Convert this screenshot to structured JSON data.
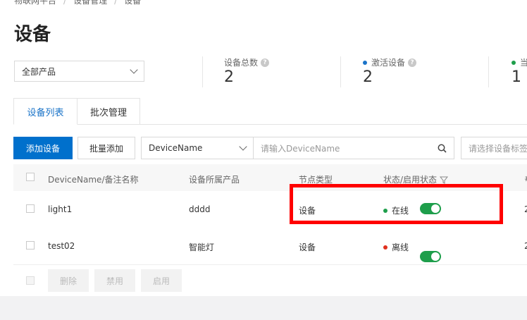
{
  "breadcrumb": [
    "物联网平台",
    "设备管理",
    "设备"
  ],
  "page_title": "设备",
  "product_filter": {
    "value": "全部产品"
  },
  "stats": [
    {
      "label": "设备总数",
      "value": "2",
      "dot_color": null
    },
    {
      "label": "激活设备",
      "value": "2",
      "dot_color": "#1a73c8"
    },
    {
      "label": "当",
      "value": "1",
      "dot_color": "#1e9e4b"
    }
  ],
  "tabs": [
    {
      "label": "设备列表",
      "active": true
    },
    {
      "label": "批次管理",
      "active": false
    }
  ],
  "toolbar": {
    "add_device": "添加设备",
    "batch_add": "批量添加",
    "search_field": "DeviceName",
    "search_placeholder": "请输入DeviceName",
    "tag_placeholder": "请选择设备标签"
  },
  "table": {
    "headers": [
      "DeviceName/备注名称",
      "设备所属产品",
      "节点类型",
      "状态/启用状态"
    ],
    "rows": [
      {
        "name": "light1",
        "product": "dddd",
        "node_type": "设备",
        "status": "在线",
        "status_color": "#1e9e4b",
        "enabled": true,
        "extra": "2"
      },
      {
        "name": "test02",
        "product": "智能灯",
        "node_type": "设备",
        "status": "离线",
        "status_color": "#e0301e",
        "enabled": true,
        "extra": "2"
      }
    ]
  },
  "footer_actions": {
    "delete": "删除",
    "disable": "禁用",
    "enable": "启用"
  },
  "colors": {
    "primary": "#0070cc",
    "online": "#1e9e4b",
    "offline": "#e0301e",
    "highlight": "#ff0000"
  }
}
